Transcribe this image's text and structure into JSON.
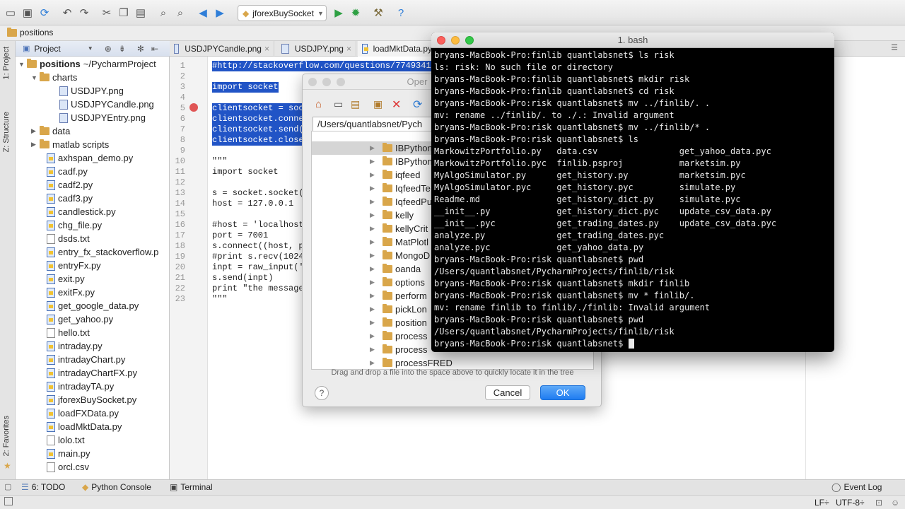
{
  "toolbar": {
    "run_config": "jforexBuySocket"
  },
  "navbar": {
    "breadcrumb": "positions"
  },
  "side_tabs": {
    "project": "1: Project",
    "structure": "Z: Structure",
    "favorites": "2: Favorites"
  },
  "project_panel": {
    "header": "Project",
    "root": "positions",
    "root_path": "~/PycharmProject",
    "items": [
      {
        "label": "charts",
        "kind": "folder",
        "depth": 1,
        "open": true
      },
      {
        "label": "USDJPY.png",
        "kind": "img",
        "depth": 2
      },
      {
        "label": "USDJPYCandle.png",
        "kind": "img",
        "depth": 2
      },
      {
        "label": "USDJPYEntry.png",
        "kind": "img",
        "depth": 2
      },
      {
        "label": "data",
        "kind": "folder",
        "depth": 1,
        "open": false
      },
      {
        "label": "matlab scripts",
        "kind": "folder",
        "depth": 1,
        "open": false
      },
      {
        "label": "axhspan_demo.py",
        "kind": "py",
        "depth": 1
      },
      {
        "label": "cadf.py",
        "kind": "py",
        "depth": 1
      },
      {
        "label": "cadf2.py",
        "kind": "py",
        "depth": 1
      },
      {
        "label": "cadf3.py",
        "kind": "py",
        "depth": 1
      },
      {
        "label": "candlestick.py",
        "kind": "py",
        "depth": 1
      },
      {
        "label": "chg_file.py",
        "kind": "py",
        "depth": 1
      },
      {
        "label": "dsds.txt",
        "kind": "txt",
        "depth": 1
      },
      {
        "label": "entry_fx_stackoverflow.p",
        "kind": "py",
        "depth": 1
      },
      {
        "label": "entryFx.py",
        "kind": "py",
        "depth": 1
      },
      {
        "label": "exit.py",
        "kind": "py",
        "depth": 1
      },
      {
        "label": "exitFx.py",
        "kind": "py",
        "depth": 1
      },
      {
        "label": "get_google_data.py",
        "kind": "py",
        "depth": 1
      },
      {
        "label": "get_yahoo.py",
        "kind": "py",
        "depth": 1
      },
      {
        "label": "hello.txt",
        "kind": "txt",
        "depth": 1
      },
      {
        "label": "intraday.py",
        "kind": "py",
        "depth": 1
      },
      {
        "label": "intradayChart.py",
        "kind": "py",
        "depth": 1
      },
      {
        "label": "intradayChartFX.py",
        "kind": "py",
        "depth": 1
      },
      {
        "label": "intradayTA.py",
        "kind": "py",
        "depth": 1
      },
      {
        "label": "jforexBuySocket.py",
        "kind": "py",
        "depth": 1
      },
      {
        "label": "loadFXData.py",
        "kind": "py",
        "depth": 1
      },
      {
        "label": "loadMktData.py",
        "kind": "py",
        "depth": 1
      },
      {
        "label": "lolo.txt",
        "kind": "txt",
        "depth": 1
      },
      {
        "label": "main.py",
        "kind": "py",
        "depth": 1
      },
      {
        "label": "orcl.csv",
        "kind": "txt",
        "depth": 1
      }
    ]
  },
  "tabs": [
    "USDJPYCandle.png",
    "USDJPY.png",
    "loadMktData.py"
  ],
  "editor": {
    "line_numbers": [
      "1",
      "2",
      "3",
      "4",
      "5",
      "6",
      "7",
      "8",
      "9",
      "10",
      "11",
      "12",
      "13",
      "14",
      "15",
      "16",
      "17",
      "18",
      "19",
      "20",
      "21",
      "22",
      "23"
    ],
    "lines": [
      {
        "text": "#http://stackoverflow.com/questions/7749341/",
        "selected": true
      },
      {
        "text": "",
        "selected": false
      },
      {
        "text": "import socket",
        "selected": true
      },
      {
        "text": "",
        "selected": false
      },
      {
        "text": "clientsocket = soc",
        "selected": true
      },
      {
        "text": "clientsocket.conne",
        "selected": true
      },
      {
        "text": "clientsocket.send(",
        "selected": true
      },
      {
        "text": "clientsocket.close",
        "selected": true
      },
      {
        "text": "",
        "selected": false
      },
      {
        "text": "\"\"\"",
        "selected": false
      },
      {
        "text": "import socket",
        "selected": false
      },
      {
        "text": "",
        "selected": false
      },
      {
        "text": "s = socket.socket(",
        "selected": false
      },
      {
        "text": "host = 127.0.0.1",
        "selected": false
      },
      {
        "text": "",
        "selected": false
      },
      {
        "text": "#host = 'localhost",
        "selected": false
      },
      {
        "text": "port = 7001",
        "selected": false
      },
      {
        "text": "s.connect((host, p",
        "selected": false
      },
      {
        "text": "#print s.recv(1024",
        "selected": false
      },
      {
        "text": "inpt = raw_input('",
        "selected": false
      },
      {
        "text": "s.send(inpt)",
        "selected": false
      },
      {
        "text": "print \"the message",
        "selected": false
      },
      {
        "text": "\"\"\"",
        "selected": false
      }
    ]
  },
  "dialog": {
    "title": "Oper",
    "path": "/Users/quantlabsnet/Pych",
    "tree": [
      "IBPython",
      "IBPython",
      "iqfeed",
      "IqfeedTe",
      "IqfeedPush",
      "kelly",
      "kellyCrit",
      "MatPlotl",
      "MongoD",
      "oanda",
      "options",
      "perform",
      "pickLon",
      "position",
      "process",
      "process",
      "processFRED"
    ],
    "hint": "Drag and drop a file into the space above to quickly locate it in the tree",
    "cancel": "Cancel",
    "ok": "OK"
  },
  "terminal": {
    "title": "1. bash",
    "lines": [
      "bryans-MacBook-Pro:finlib quantlabsnet$ ls risk",
      "ls: risk: No such file or directory",
      "bryans-MacBook-Pro:finlib quantlabsnet$ mkdir risk",
      "bryans-MacBook-Pro:finlib quantlabsnet$ cd risk",
      "bryans-MacBook-Pro:risk quantlabsnet$ mv ../finlib/. .",
      "mv: rename ../finlib/. to ./.: Invalid argument",
      "bryans-MacBook-Pro:risk quantlabsnet$ mv ../finlib/* .",
      "bryans-MacBook-Pro:risk quantlabsnet$ ls",
      "MarkowitzPortfolio.py   data.csv                get_yahoo_data.pyc",
      "MarkowitzPortfolio.pyc  finlib.psproj           marketsim.py",
      "MyAlgoSimulator.py      get_history.py          marketsim.pyc",
      "MyAlgoSimulator.pyc     get_history.pyc         simulate.py",
      "Readme.md               get_history_dict.py     simulate.pyc",
      "__init__.py             get_history_dict.pyc    update_csv_data.py",
      "__init__.pyc            get_trading_dates.py    update_csv_data.pyc",
      "analyze.py              get_trading_dates.pyc",
      "analyze.pyc             get_yahoo_data.py",
      "bryans-MacBook-Pro:risk quantlabsnet$ pwd",
      "/Users/quantlabsnet/PycharmProjects/finlib/risk",
      "bryans-MacBook-Pro:risk quantlabsnet$ mkdir finlib",
      "bryans-MacBook-Pro:risk quantlabsnet$ mv * finlib/.",
      "mv: rename finlib to finlib/./finlib: Invalid argument",
      "bryans-MacBook-Pro:risk quantlabsnet$ pwd",
      "/Users/quantlabsnet/PycharmProjects/finlib/risk"
    ],
    "prompt": "bryans-MacBook-Pro:risk quantlabsnet$ "
  },
  "bottom_bar": {
    "todo": "6: TODO",
    "python_console": "Python Console",
    "terminal": "Terminal",
    "event_log": "Event Log"
  },
  "status_bar": {
    "line_sep": "LF÷",
    "encoding": "UTF-8÷"
  }
}
